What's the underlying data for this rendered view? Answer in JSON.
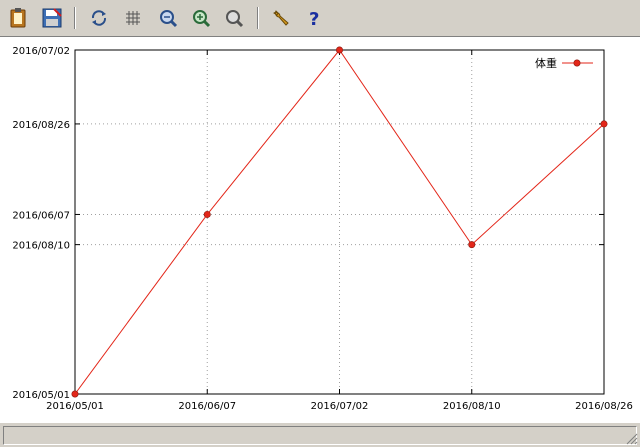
{
  "toolbar": {
    "buttons": [
      {
        "name": "copy-clipboard-button",
        "icon": "clipboard-icon"
      },
      {
        "name": "save-button",
        "icon": "floppy-disk-icon"
      },
      {
        "name": "replot-button",
        "icon": "refresh-icon"
      },
      {
        "name": "grid-button",
        "icon": "grid-icon"
      },
      {
        "name": "zoom-previous-button",
        "icon": "zoom-previous-icon"
      },
      {
        "name": "zoom-next-button",
        "icon": "zoom-next-icon"
      },
      {
        "name": "unzoom-button",
        "icon": "zoom-reset-icon"
      },
      {
        "name": "options-button",
        "icon": "wrench-icon"
      },
      {
        "name": "help-button",
        "icon": "help-icon"
      }
    ]
  },
  "colors": {
    "series": "#e32619",
    "grid": "#a0a0a0"
  },
  "chart_data": {
    "type": "line",
    "title": "",
    "xlabel": "",
    "ylabel": "",
    "x_ticks": [
      "2016/05/01",
      "2016/06/07",
      "2016/07/02",
      "2016/08/10",
      "2016/08/26"
    ],
    "y_ticks": [
      "2016/05/01",
      "2016/08/10",
      "2016/06/07",
      "2016/08/26",
      "2016/07/02"
    ],
    "y_tick_values": [
      0,
      49.5,
      59.5,
      89.5,
      114
    ],
    "ylim": [
      0,
      114
    ],
    "grid": true,
    "legend_position": "top-right",
    "series": [
      {
        "name": "体重",
        "color": "#e32619",
        "x": [
          "2016/05/01",
          "2016/06/07",
          "2016/07/02",
          "2016/08/10",
          "2016/08/26"
        ],
        "y": [
          0,
          59.5,
          114,
          49.5,
          89.5
        ]
      }
    ]
  },
  "statusbar": {
    "text": ""
  }
}
